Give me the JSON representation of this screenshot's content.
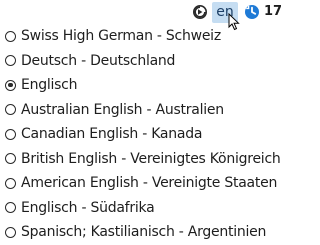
{
  "toolbar": {
    "restore_icon": "restore-icon",
    "language_code": "en",
    "history_icon": "history-icon",
    "count": "17",
    "accent_color": "#1f7ad6",
    "highlight_color": "#c5ddf2"
  },
  "languages": {
    "selected_index": 2,
    "items": [
      {
        "label": "Swiss High German - Schweiz",
        "selected": false
      },
      {
        "label": "Deutsch - Deutschland",
        "selected": false
      },
      {
        "label": "Englisch",
        "selected": true
      },
      {
        "label": "Australian English - Australien",
        "selected": false
      },
      {
        "label": "Canadian English - Kanada",
        "selected": false
      },
      {
        "label": "British English - Vereinigtes Königreich",
        "selected": false
      },
      {
        "label": "American English - Vereinigte Staaten",
        "selected": false
      },
      {
        "label": "Englisch - Südafrika",
        "selected": false
      },
      {
        "label": "Spanisch; Kastilianisch - Argentinien",
        "selected": false
      }
    ]
  }
}
